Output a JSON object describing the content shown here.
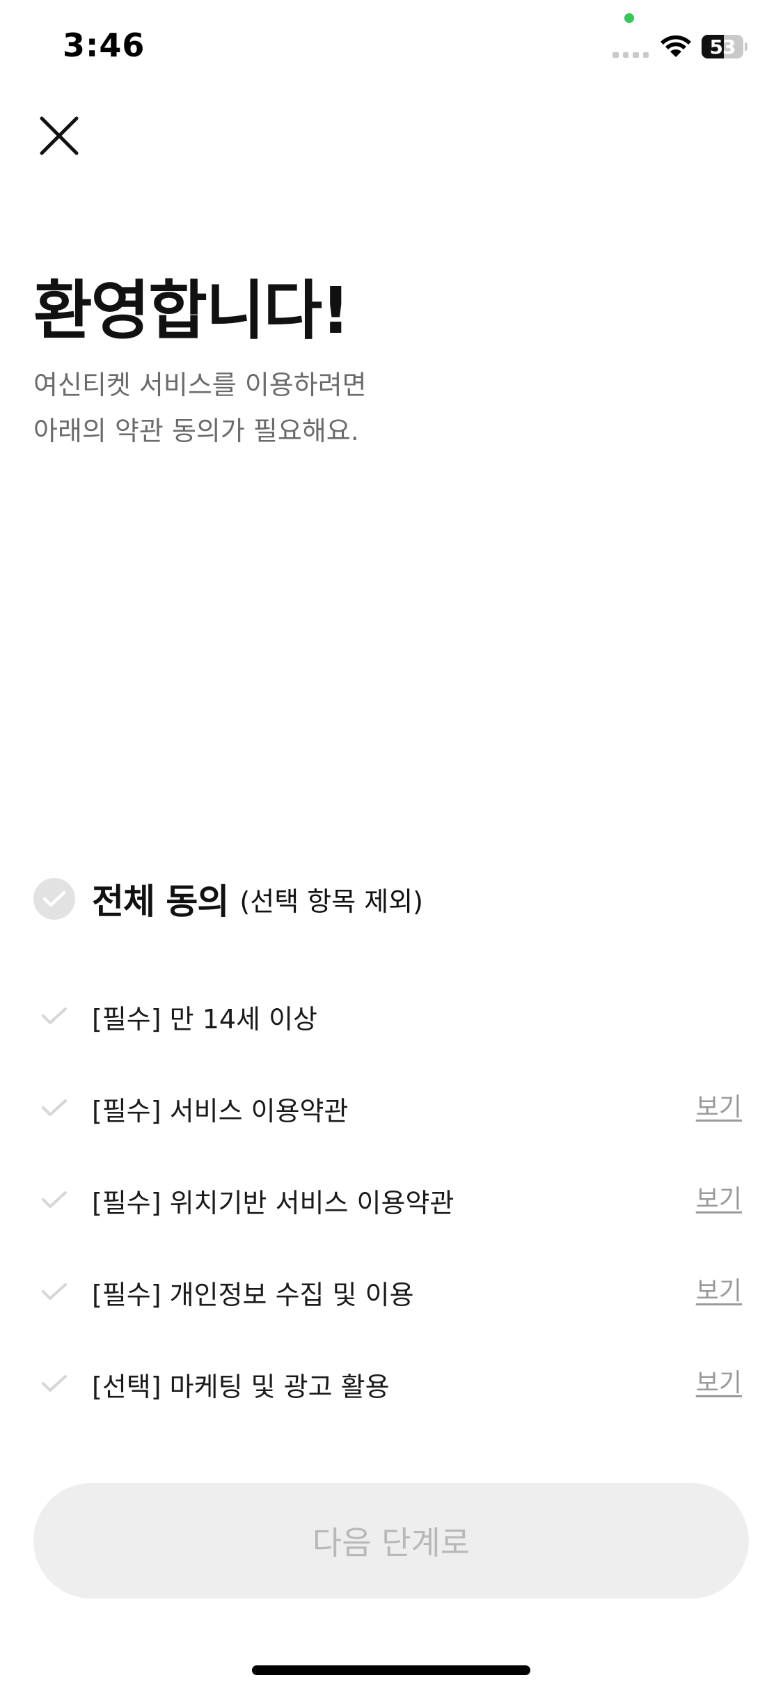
{
  "status_bar": {
    "time": "3:46",
    "battery_level": "53",
    "battery_fraction": 0.53
  },
  "header": {
    "close_icon": "close-icon"
  },
  "intro": {
    "title": "환영합니다!",
    "subtitle_line1": "여신티켓 서비스를 이용하려면",
    "subtitle_line2": "아래의 약관 동의가 필요해요."
  },
  "agree_all": {
    "label": "전체 동의",
    "note": "(선택 항목 제외)",
    "checked": false
  },
  "terms": [
    {
      "label": "[필수] 만 14세 이상",
      "view_label": "",
      "checked": false
    },
    {
      "label": "[필수] 서비스 이용약관",
      "view_label": "보기",
      "checked": false
    },
    {
      "label": "[필수] 위치기반 서비스 이용약관",
      "view_label": "보기",
      "checked": false
    },
    {
      "label": "[필수] 개인정보 수집 및 이용",
      "view_label": "보기",
      "checked": false
    },
    {
      "label": "[선택] 마케팅 및 광고 활용",
      "view_label": "보기",
      "checked": false
    }
  ],
  "next_button": {
    "label": "다음 단계로",
    "enabled": false
  },
  "colors": {
    "check_inactive": "#d6d6d6",
    "check_circle_bg": "#e2e2e2",
    "button_disabled_bg": "#eeeeee",
    "button_disabled_text": "#b8b8b8",
    "status_dot": "#34c759"
  }
}
